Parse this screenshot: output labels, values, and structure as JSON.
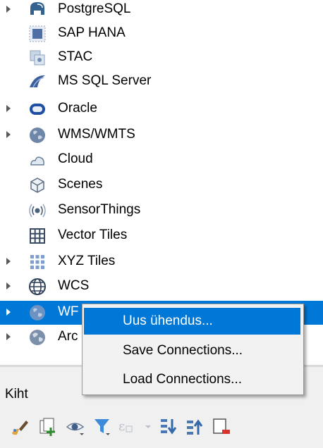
{
  "browser_tree": {
    "items": [
      {
        "label": "PostgreSQL",
        "icon": "postgresql-elephant-icon",
        "expandable": true
      },
      {
        "label": "SAP HANA",
        "icon": "sap-hana-icon",
        "expandable": false
      },
      {
        "label": "STAC",
        "icon": "stac-icon",
        "expandable": false
      },
      {
        "label": "MS SQL Server",
        "icon": "mssql-server-icon",
        "expandable": false
      },
      {
        "label": "Oracle",
        "icon": "oracle-icon",
        "expandable": true
      },
      {
        "label": "WMS/WMTS",
        "icon": "wms-globe-icon",
        "expandable": true
      },
      {
        "label": "Cloud",
        "icon": "cloud-icon",
        "expandable": false
      },
      {
        "label": "Scenes",
        "icon": "scenes-cube-icon",
        "expandable": false
      },
      {
        "label": "SensorThings",
        "icon": "sensorthings-icon",
        "expandable": false
      },
      {
        "label": "Vector Tiles",
        "icon": "vector-tiles-grid-icon",
        "expandable": false
      },
      {
        "label": "XYZ Tiles",
        "icon": "xyz-tiles-icon",
        "expandable": true
      },
      {
        "label": "WCS",
        "icon": "wcs-globe-icon",
        "expandable": true
      },
      {
        "label": "WF",
        "icon": "wfs-globe-icon",
        "expandable": true,
        "selected": true
      },
      {
        "label": "Arc",
        "icon": "arcgis-globe-icon",
        "expandable": true
      }
    ]
  },
  "context_menu": {
    "items": [
      {
        "label": "Uus ühendus...",
        "highlighted": true
      },
      {
        "label": "Save Connections...",
        "highlighted": false
      },
      {
        "label": "Load Connections...",
        "highlighted": false
      }
    ]
  },
  "layers_panel": {
    "title": "Kiht",
    "toolbar_icons": [
      "style-brush-icon",
      "add-group-icon",
      "manage-visibility-eye-icon",
      "filter-legend-icon",
      "filter-expression-icon",
      "expand-all-icon",
      "collapse-all-icon",
      "remove-layer-icon"
    ]
  },
  "colors": {
    "selection": "#0078d7",
    "menu_background": "#f2f2f2",
    "panel_background": "#f0f0f0"
  }
}
